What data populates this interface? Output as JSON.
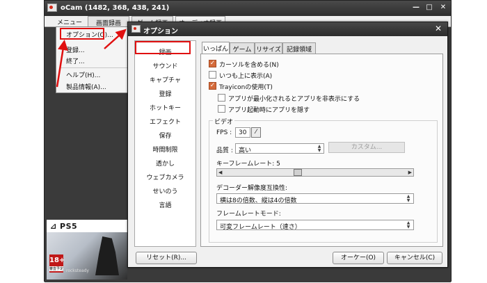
{
  "main_window": {
    "title": "oCam (1482, 368, 438, 241)",
    "controls": {
      "minimize": "—",
      "maximize": "□",
      "close": "✕"
    },
    "menu": [
      "メニュー",
      "画面録画",
      "ゲーム録画",
      "オーディオ録画"
    ],
    "dropdown": {
      "items": [
        "オプション(O)...",
        "登録...",
        "終了...",
        "ヘルプ(H)...",
        "製品情報(A)..."
      ]
    }
  },
  "ad": {
    "brand": "PS5",
    "rating": "18+",
    "rating_note": "審査予定",
    "publisher": "rocksteady"
  },
  "dialog": {
    "title": "オプション",
    "close": "✕",
    "categories": [
      "録画",
      "サウンド",
      "キャプチャ",
      "登録",
      "ホットキー",
      "エフェクト",
      "保存",
      "時間制限",
      "透かし",
      "ウェブカメラ",
      "せいのう",
      "言語"
    ],
    "tabs": [
      "いっぱん",
      "ゲーム",
      "リサイズ",
      "記録領域"
    ],
    "options": {
      "include_cursor": "カーソルを含める(N)",
      "always_on_top": "いつも上に表示(A)",
      "trayicon": "Trayiconの使用(T)",
      "hide_on_minimize": "アプリが最小化されるとアプリを非表示にする",
      "hide_on_start": "アプリ起動時にアプリを隠す"
    },
    "checked": {
      "include_cursor": true,
      "always_on_top": false,
      "trayicon": true,
      "hide_on_minimize": false,
      "hide_on_start": false
    },
    "video": {
      "group_title": "ビデオ",
      "fps_label": "FPS :",
      "fps_value": "30",
      "quality_label": "品質 :",
      "quality_value": "高い",
      "custom_button": "カスタム...",
      "keyframe_label": "キーフレームレート: 5",
      "keyframe_slider_fraction": 0.4,
      "decoder_label": "デコーダー解像度互換性:",
      "decoder_value": "横は8の倍数、縦は4の倍数",
      "framerate_mode_label": "フレームレートモード:",
      "framerate_mode_value": "可変フレームレート（速さ）"
    },
    "buttons": {
      "reset": "リセット(R)...",
      "ok": "オーケー(O)",
      "cancel": "キャンセル(C)"
    }
  },
  "colors": {
    "highlight": "#e01010",
    "checkbox_on": "#d46a3a",
    "title_bar": "#2c2c2c"
  }
}
